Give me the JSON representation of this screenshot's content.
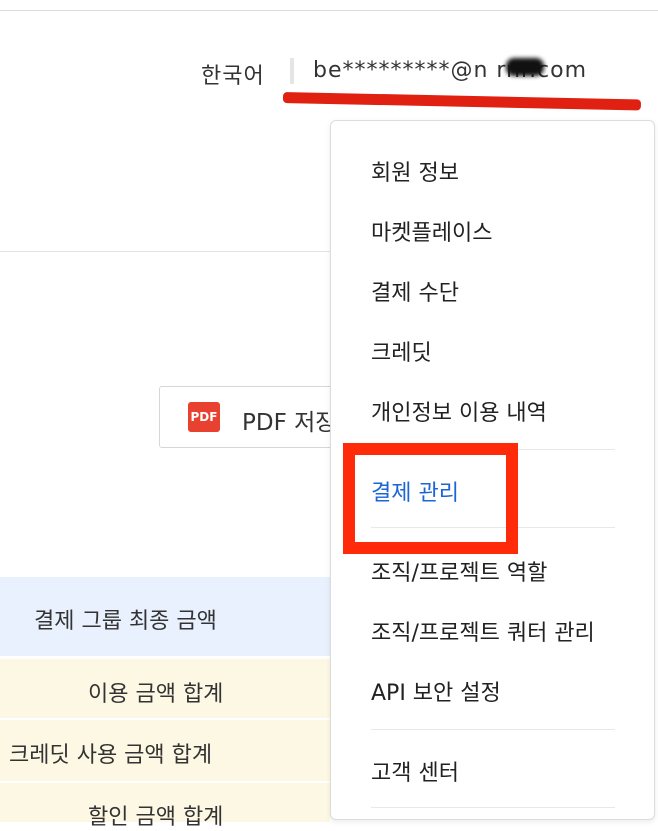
{
  "header": {
    "language": "한국어",
    "account_email": "be*********@n     rnr.com"
  },
  "toolbar": {
    "pdf_icon_text": "PDF",
    "pdf_button_label": "PDF 저장"
  },
  "table": {
    "rows": [
      {
        "label": "결제 그룹 최종 금액"
      },
      {
        "label": "이용 금액 합계"
      },
      {
        "label": "크레딧 사용 금액 합계"
      },
      {
        "label": "할인 금액 합계"
      }
    ]
  },
  "dropdown": {
    "items": [
      {
        "label": "회원 정보"
      },
      {
        "label": "마켓플레이스"
      },
      {
        "label": "결제 수단"
      },
      {
        "label": "크레딧"
      },
      {
        "label": "개인정보 이용 내역"
      },
      {
        "label": "결제 관리"
      },
      {
        "label": "조직/프로젝트 역할"
      },
      {
        "label": "조직/프로젝트 쿼터 관리"
      },
      {
        "label": "API 보안 설정"
      },
      {
        "label": "고객 센터"
      }
    ],
    "active_item": "결제 관리"
  },
  "colors": {
    "active_link": "#1a66d6",
    "annotation_red": "#ff2a0a",
    "pdf_icon": "#e8412f",
    "group_row_bg": "#e9f1ff",
    "sum_row_bg": "#fdf8e4"
  }
}
